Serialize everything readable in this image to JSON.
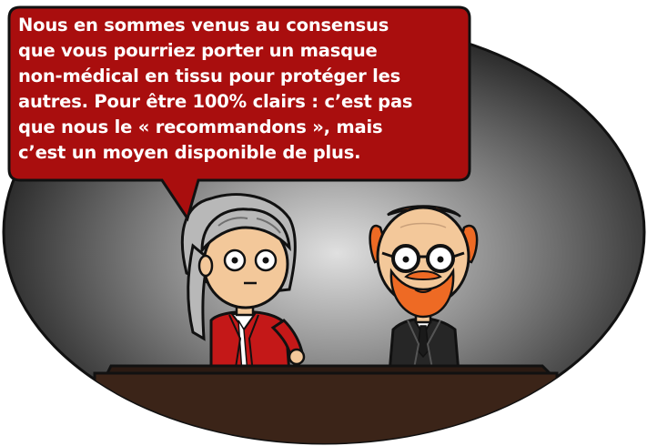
{
  "speech_bubble": {
    "text": "Nous en sommes venus au consensus\nque vous pourriez porter un masque\nnon-médical en tissu pour protéger les\nautres. Pour être 100% clairs : c’est pas\nque nous le « recommandons », mais\nc’est un moyen disponible de plus."
  },
  "colors": {
    "bubble_fill": "#a90e0e",
    "backdrop_dark": "#232323",
    "spotlight": "#d8d8d8",
    "podium": "#3b2418",
    "left_jacket": "#c41818",
    "right_jacket": "#262626",
    "right_hair_beard": "#ee6a24",
    "left_hair": "#b8b8b8",
    "skin": "#f3c89a"
  }
}
